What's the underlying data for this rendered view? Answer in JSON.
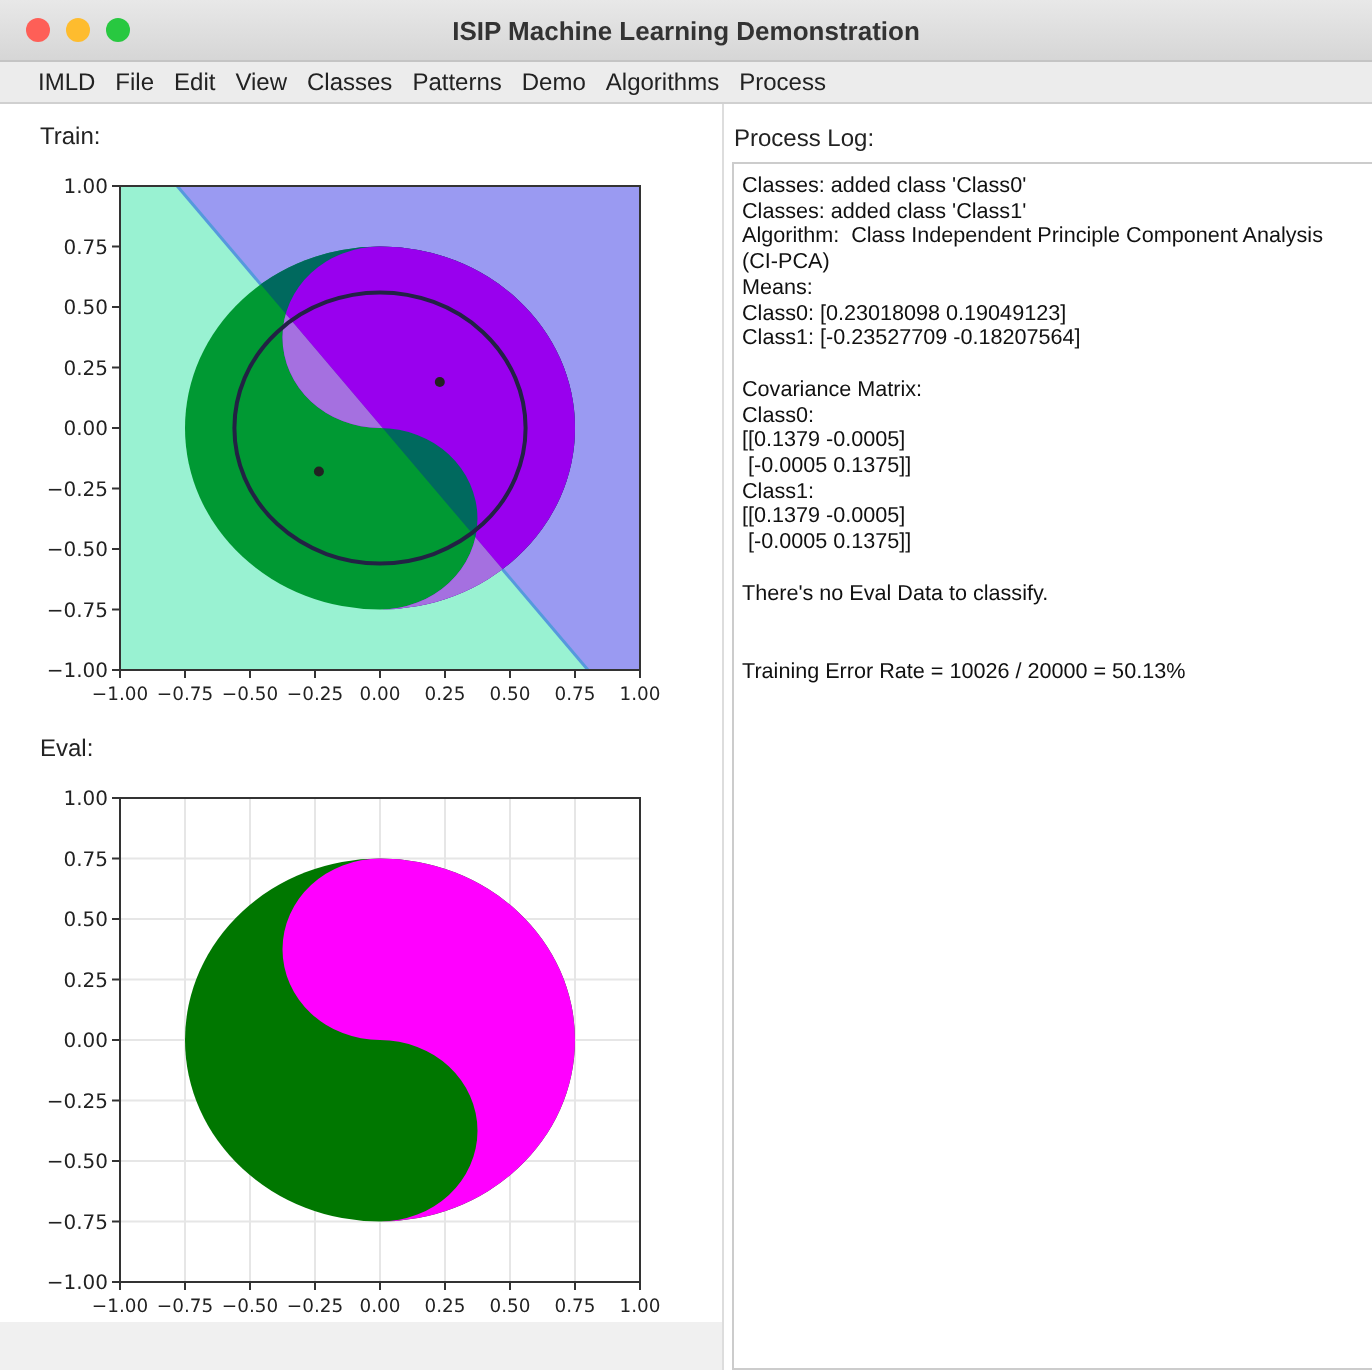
{
  "window": {
    "title": "ISIP Machine Learning Demonstration"
  },
  "menu": [
    "IMLD",
    "File",
    "Edit",
    "View",
    "Classes",
    "Patterns",
    "Demo",
    "Algorithms",
    "Process"
  ],
  "plots": [
    {
      "kind": "train",
      "label": "Train:",
      "xticks": [
        "−1.00",
        "−0.75",
        "−0.50",
        "−0.25",
        "0.00",
        "0.25",
        "0.50",
        "0.75",
        "1.00"
      ],
      "yticks": [
        "1.00",
        "0.75",
        "0.50",
        "0.25",
        "0.00",
        "−0.25",
        "−0.50",
        "−0.75",
        "−1.00"
      ]
    },
    {
      "kind": "eval",
      "label": "Eval:",
      "xticks": [
        "−1.00",
        "−0.75",
        "−0.50",
        "−0.25",
        "0.00",
        "0.25",
        "0.50",
        "0.75",
        "1.00"
      ],
      "yticks": [
        "1.00",
        "0.75",
        "0.50",
        "0.25",
        "0.00",
        "−0.25",
        "−0.50",
        "−0.75",
        "−1.00"
      ]
    }
  ],
  "log": {
    "title": "Process Log:",
    "paragraphs": [
      {
        "wide_gap": false,
        "lines": [
          "Classes: added class 'Class0'",
          "Classes: added class 'Class1'",
          "Algorithm:  Class Independent Principle Component Analysis",
          "(CI-PCA)",
          "Means:",
          "Class0: [0.23018098 0.19049123]",
          "Class1: [-0.23527709 -0.18207564]"
        ]
      },
      {
        "wide_gap": false,
        "lines": [
          "Covariance Matrix:",
          "Class0:",
          "[[0.1379 -0.0005]",
          " [-0.0005 0.1375]]",
          "Class1:",
          "[[0.1379 -0.0005]",
          " [-0.0005 0.1375]]"
        ]
      },
      {
        "wide_gap": false,
        "lines": [
          "There's no Eval Data to classify."
        ]
      },
      {
        "wide_gap": true,
        "lines": [
          "Training Error Rate = 10026 / 20000 = 50.13%"
        ]
      }
    ]
  }
}
